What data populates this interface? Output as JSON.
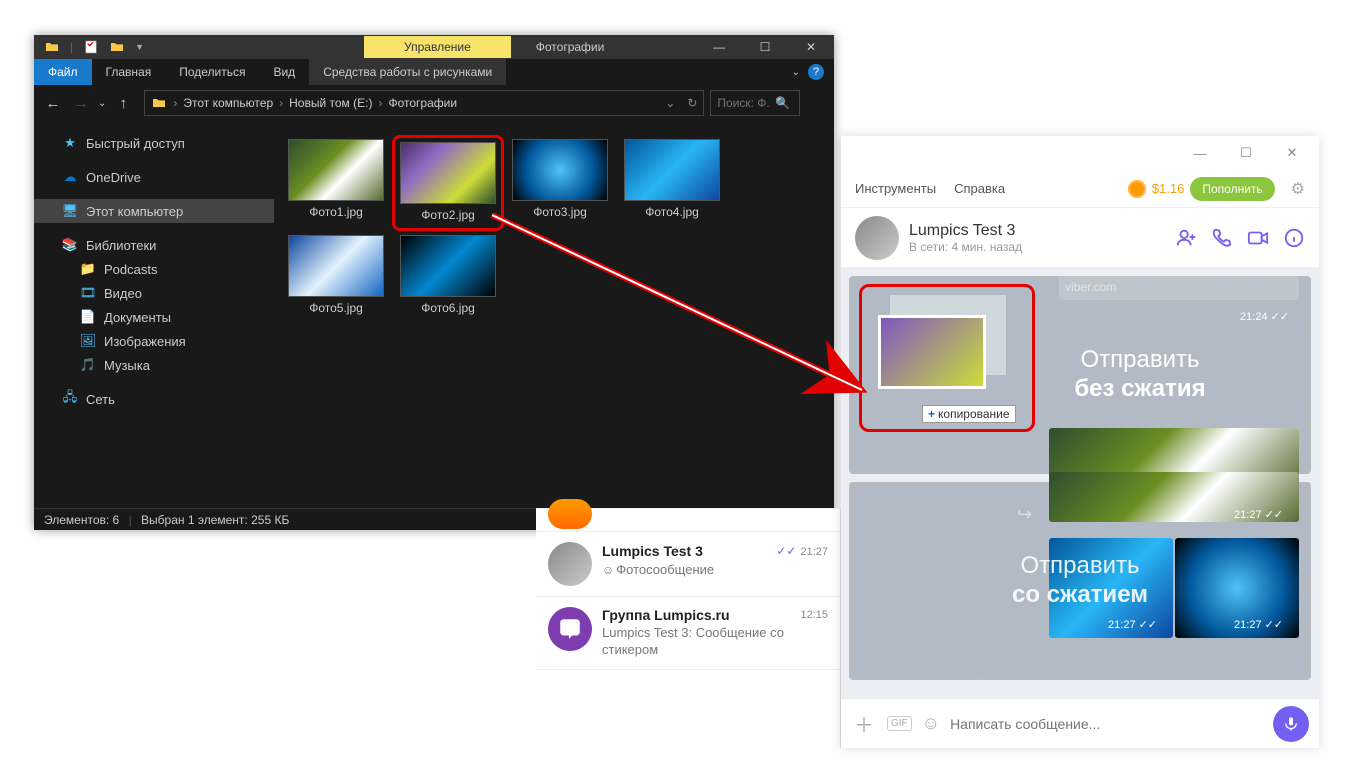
{
  "explorer": {
    "title_tab": "Управление",
    "title_text": "Фотографии",
    "ribbon": {
      "file": "Файл",
      "home": "Главная",
      "share": "Поделиться",
      "view": "Вид",
      "picture_tools": "Средства работы с рисунками"
    },
    "path": {
      "pc": "Этот компьютер",
      "vol": "Новый том (E:)",
      "folder": "Фотографии"
    },
    "search_placeholder": "Поиск: Ф...",
    "sidebar": {
      "quick": "Быстрый доступ",
      "onedrive": "OneDrive",
      "thispc": "Этот компьютер",
      "libraries": "Библиотеки",
      "podcasts": "Podcasts",
      "video": "Видео",
      "documents": "Документы",
      "images": "Изображения",
      "music": "Музыка",
      "network": "Сеть"
    },
    "files": [
      {
        "name": "Фото1.jpg"
      },
      {
        "name": "Фото2.jpg"
      },
      {
        "name": "Фото3.jpg"
      },
      {
        "name": "Фото4.jpg"
      },
      {
        "name": "Фото5.jpg"
      },
      {
        "name": "Фото6.jpg"
      }
    ],
    "status_left": "Элементов: 6",
    "status_sel": "Выбран 1 элемент: 255 КБ"
  },
  "viber_list": {
    "items": [
      {
        "name": "Lumpics Test 3",
        "msg": "Фотосообщение",
        "time": "21:27",
        "read": true,
        "emoji": true
      },
      {
        "name": "Группа Lumpics.ru",
        "msg": "Lumpics Test 3: Сообщение со стикером",
        "time": "12:15"
      }
    ]
  },
  "viber_chat": {
    "menu": {
      "tools": "Инструменты",
      "help": "Справка"
    },
    "balance": "$1.16",
    "topup": "Пополнить",
    "header": {
      "name": "Lumpics Test 3",
      "status": "В сети: 4 мин. назад"
    },
    "dz1": {
      "line1": "Отправить",
      "line2": "без сжатия",
      "copy": "копирование"
    },
    "dz2": {
      "line1": "Отправить",
      "line2": "со сжатием"
    },
    "times": {
      "t1": "21:24",
      "t2": "21:27",
      "t3": "21:27",
      "t4": "21:27"
    },
    "url_hint": "viber.com",
    "input_placeholder": "Написать сообщение..."
  }
}
